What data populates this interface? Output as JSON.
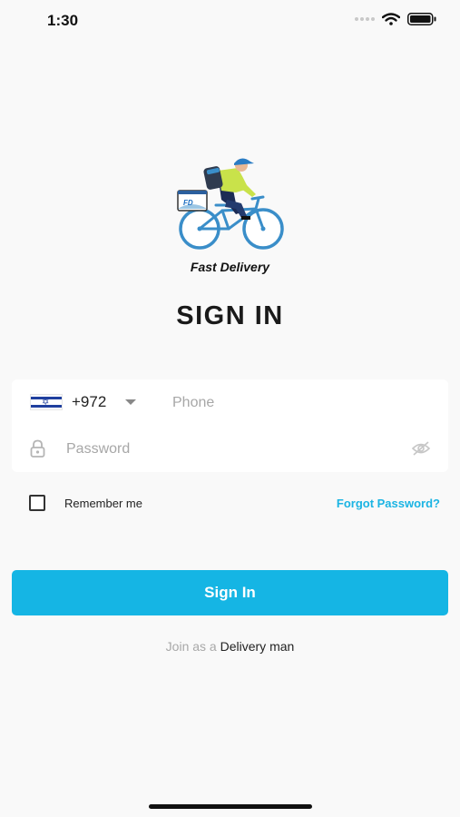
{
  "status_bar": {
    "time": "1:30"
  },
  "brand": {
    "name": "Fast Delivery",
    "badge": "FD"
  },
  "page_title": "SIGN IN",
  "form": {
    "country_code": "+972",
    "phone_placeholder": "Phone",
    "phone_value": "",
    "password_placeholder": "Password",
    "password_value": "",
    "remember_label": "Remember me",
    "remember_checked": false,
    "forgot_label": "Forgot Password?"
  },
  "signin_button_label": "Sign In",
  "join": {
    "prefix": "Join as a",
    "link_label": "Delivery man"
  },
  "colors": {
    "accent": "#15b5e4",
    "background": "#f9f9f9",
    "title": "#1a1a1a",
    "rider_shirt": "#c9e24a",
    "rider_pants": "#1c2c55",
    "bike": "#3a8ec9"
  },
  "icons": [
    "cellular-signal-icon",
    "wifi-icon",
    "battery-icon",
    "israel-flag-icon",
    "chevron-down-icon",
    "lock-icon",
    "eye-off-icon",
    "delivery-bike-logo"
  ]
}
